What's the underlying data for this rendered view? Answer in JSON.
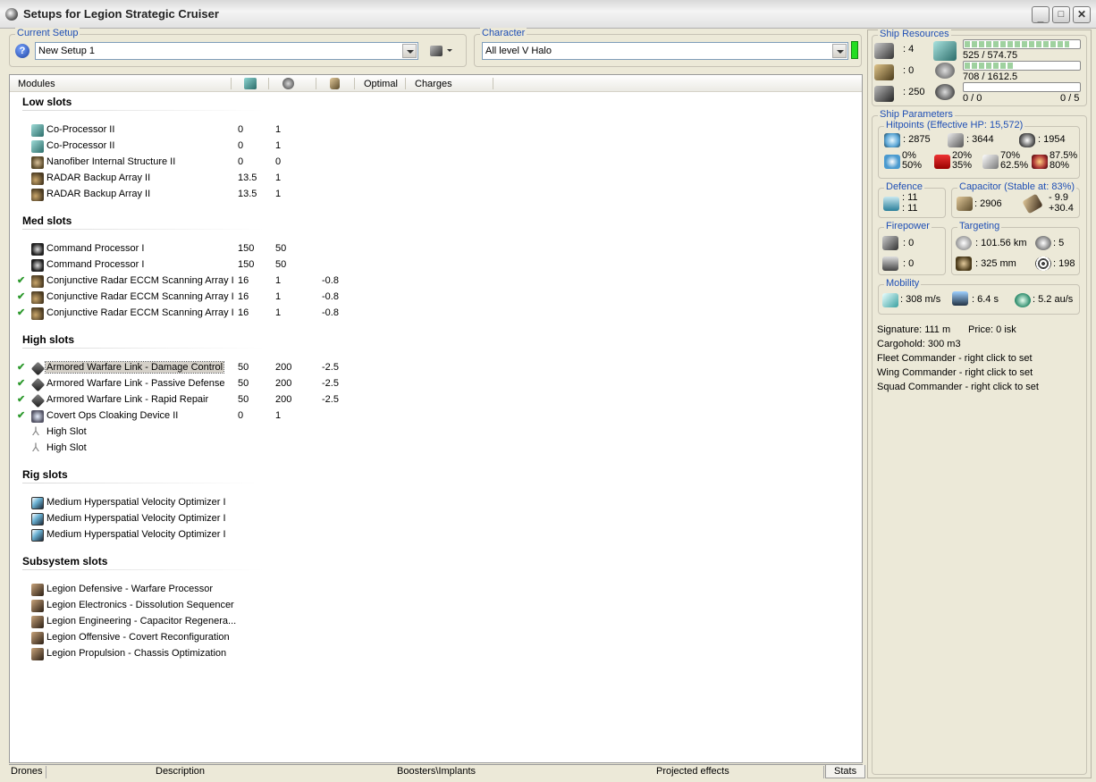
{
  "window": {
    "title": "Setups for Legion Strategic Cruiser"
  },
  "current_setup": {
    "label": "Current Setup",
    "value": "New Setup 1",
    "help_icon": "question-icon"
  },
  "character": {
    "label": "Character",
    "value": "All level V Halo"
  },
  "columns": {
    "modules": "Modules",
    "optimal": "Optimal",
    "charges": "Charges",
    "icons": [
      "cpu-icon",
      "powergrid-icon",
      "capacitor-icon"
    ]
  },
  "sections": {
    "low": "Low slots",
    "med": "Med slots",
    "high": "High slots",
    "rig": "Rig slots",
    "subsystem": "Subsystem slots"
  },
  "low_slots": [
    {
      "name": "Co-Processor II",
      "cpu": "0",
      "pg": "1",
      "cap": "",
      "active": false
    },
    {
      "name": "Co-Processor II",
      "cpu": "0",
      "pg": "1",
      "cap": "",
      "active": false
    },
    {
      "name": "Nanofiber Internal Structure II",
      "cpu": "0",
      "pg": "0",
      "cap": "",
      "active": false
    },
    {
      "name": "RADAR Backup Array II",
      "cpu": "13.5",
      "pg": "1",
      "cap": "",
      "active": false
    },
    {
      "name": "RADAR Backup Array II",
      "cpu": "13.5",
      "pg": "1",
      "cap": "",
      "active": false
    }
  ],
  "med_slots": [
    {
      "name": "Command Processor I",
      "cpu": "150",
      "pg": "50",
      "cap": "",
      "active": false
    },
    {
      "name": "Command Processor I",
      "cpu": "150",
      "pg": "50",
      "cap": "",
      "active": false
    },
    {
      "name": "Conjunctive Radar ECCM Scanning Array I",
      "cpu": "16",
      "pg": "1",
      "cap": "-0.8",
      "active": true
    },
    {
      "name": "Conjunctive Radar ECCM Scanning Array I",
      "cpu": "16",
      "pg": "1",
      "cap": "-0.8",
      "active": true
    },
    {
      "name": "Conjunctive Radar ECCM Scanning Array I",
      "cpu": "16",
      "pg": "1",
      "cap": "-0.8",
      "active": true
    }
  ],
  "high_slots": [
    {
      "name": "Armored Warfare Link - Damage Control",
      "cpu": "50",
      "pg": "200",
      "cap": "-2.5",
      "active": true,
      "selected": true
    },
    {
      "name": "Armored Warfare Link - Passive Defense",
      "cpu": "50",
      "pg": "200",
      "cap": "-2.5",
      "active": true
    },
    {
      "name": "Armored Warfare Link - Rapid Repair",
      "cpu": "50",
      "pg": "200",
      "cap": "-2.5",
      "active": true
    },
    {
      "name": "Covert Ops Cloaking Device II",
      "cpu": "0",
      "pg": "1",
      "cap": "",
      "active": true
    },
    {
      "name": "High Slot",
      "cpu": "",
      "pg": "",
      "cap": "",
      "active": false
    },
    {
      "name": "High Slot",
      "cpu": "",
      "pg": "",
      "cap": "",
      "active": false
    }
  ],
  "rig_slots": [
    {
      "name": "Medium Hyperspatial Velocity Optimizer I"
    },
    {
      "name": "Medium Hyperspatial Velocity Optimizer I"
    },
    {
      "name": "Medium Hyperspatial Velocity Optimizer I"
    }
  ],
  "subsystem_slots": [
    {
      "name": "Legion Defensive - Warfare Processor"
    },
    {
      "name": "Legion Electronics - Dissolution Sequencer"
    },
    {
      "name": "Legion Engineering - Capacitor Regenera..."
    },
    {
      "name": "Legion Offensive - Covert Reconfiguration"
    },
    {
      "name": "Legion Propulsion - Chassis Optimization"
    }
  ],
  "tabs": [
    "Drones",
    "Description",
    "Boosters\\Implants",
    "Projected effects",
    "Stats"
  ],
  "ship_resources": {
    "label": "Ship Resources",
    "turret_hardpoints": ": 4",
    "launcher_hardpoints": ": 0",
    "calibration": ": 250",
    "cpu": "525 / 574.75",
    "cpu_fraction": 0.913,
    "powergrid": "708 / 1612.5",
    "powergrid_fraction": 0.439,
    "drone_bandwidth": "0 / 0",
    "drone_bay": "0 / 5",
    "drone_fraction": 0
  },
  "ship_parameters": {
    "label": "Ship Parameters",
    "hitpoints_label": "Hitpoints (Effective HP: 15,572)",
    "shield_hp": ": 2875",
    "armor_hp": ": 3644",
    "structure_hp": ": 1954",
    "resists": [
      {
        "top": "0%",
        "bottom": "50%"
      },
      {
        "top": "20%",
        "bottom": "35%"
      },
      {
        "top": "70%",
        "bottom": "62.5%"
      },
      {
        "top": "87.5%",
        "bottom": "80%"
      }
    ],
    "defence_label": "Defence",
    "defence_top": ": 11",
    "defence_bottom": ": 11",
    "capacitor_label": "Capacitor (Stable at: 83%)",
    "capacitor_amount": ": 2906",
    "capacitor_top": "- 9.9",
    "capacitor_bottom": "+30.4",
    "firepower_label": "Firepower",
    "firepower_top": ": 0",
    "firepower_bottom": ": 0",
    "targeting_label": "Targeting",
    "targeting_range": ": 101.56 km",
    "targets": ": 5",
    "scan_res": ": 325 mm",
    "sensor_strength": ": 198",
    "mobility_label": "Mobility",
    "speed": ": 308 m/s",
    "align": ": 6.4 s",
    "warp": ": 5.2 au/s",
    "signature": "Signature: 111 m",
    "price": "Price: 0 isk",
    "cargohold": "Cargohold: 300 m3",
    "fleet_commander": "Fleet Commander - right click to set",
    "wing_commander": "Wing Commander - right click to set",
    "squad_commander": "Squad Commander - right click to set"
  }
}
